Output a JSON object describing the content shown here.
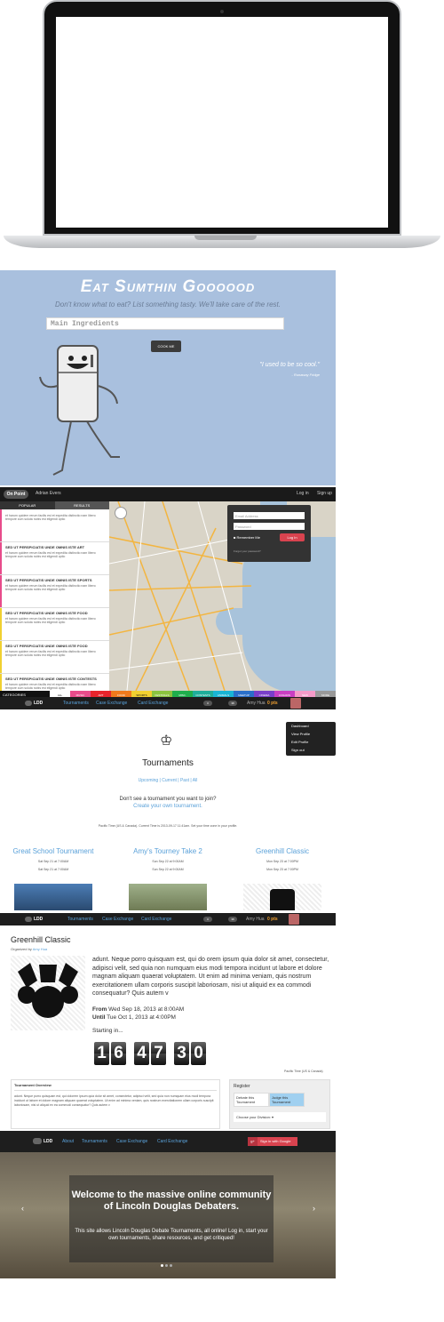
{
  "eat": {
    "title": "Eat Sumthin Goooood",
    "subtitle": "Don't know what to eat? List something tasty. We'll take care of the rest.",
    "placeholder": "Main Ingredients",
    "button": "COOK ME",
    "quote": "\"I used to be so cool.\"",
    "quote_by": "- Runaway Fridge"
  },
  "mapapp": {
    "brand": "On Point",
    "nav_left": "Adrian Evers",
    "login": "Log in",
    "signup": "Sign up",
    "tabs": [
      "POPULAR",
      "RESULTS"
    ],
    "items": [
      {
        "title": "",
        "desc": "et harum quidem rerum facilis est et expedita distinctio nam libero tempore cum soluta nobis est eligendi optio",
        "color": "#e84c8b"
      },
      {
        "title": "SED UT PERSPICIATIS UNDE OMNIS ISTE ART",
        "desc": "et harum quidem rerum facilis est et expedita distinctio nam libero tempore cum soluta nobis est eligendi optio",
        "color": "#e84c8b"
      },
      {
        "title": "SED UT PERSPICIATIS UNDE OMNIS ISTE SPORTS",
        "desc": "et harum quidem rerum facilis est et expedita distinctio nam libero tempore cum soluta nobis est eligendi optio",
        "color": "#e84c8b"
      },
      {
        "title": "SED UT PERSPICIATIS UNDE OMNIS ISTE FOOD",
        "desc": "et harum quidem rerum facilis est et expedita distinctio nam libero tempore cum soluta nobis est eligendi optio",
        "color": "#f0d030"
      },
      {
        "title": "SED UT PERSPICIATIS UNDE OMNIS ISTE FOOD",
        "desc": "et harum quidem rerum facilis est et expedita distinctio nam libero tempore cum soluta nobis est eligendi optio",
        "color": "#f0d030"
      },
      {
        "title": "SED UT PERSPICIATIS UNDE OMNIS ISTE CONTESTS",
        "desc": "et harum quidem rerum facilis est et expedita distinctio nam libero tempore cum soluta nobis est eligendi optio",
        "color": "#f0d030"
      }
    ],
    "email_ph": "Email Address",
    "pass_ph": "Password",
    "remember": "Remember Me",
    "login_btn": "Log In",
    "forgot": "Forgot your password?",
    "categories_label": "CATEGORIES",
    "categories": [
      {
        "name": "ALL",
        "color": "#ffffff",
        "text": "#111"
      },
      {
        "name": "MUSIC",
        "color": "#e84c8b",
        "text": "#fff"
      },
      {
        "name": "ART",
        "color": "#e8242c",
        "text": "#fff"
      },
      {
        "name": "FOOD",
        "color": "#f07a1c",
        "text": "#fff"
      },
      {
        "name": "SPORTS",
        "color": "#f0d030",
        "text": "#111"
      },
      {
        "name": "FESTIVALS",
        "color": "#8bc43f",
        "text": "#fff"
      },
      {
        "name": "MISC.",
        "color": "#1fae4c",
        "text": "#fff"
      },
      {
        "name": "CONTESTS",
        "color": "#1fae9a",
        "text": "#fff"
      },
      {
        "name": "ANIMALS",
        "color": "#19b5d4",
        "text": "#fff"
      },
      {
        "name": "MEETUP",
        "color": "#2a6fc9",
        "text": "#fff"
      },
      {
        "name": "CINEMA",
        "color": "#7a3fc9",
        "text": "#fff"
      },
      {
        "name": "FASHION",
        "color": "#c93fc2",
        "text": "#fff"
      },
      {
        "name": "NEW",
        "color": "#f59bc9",
        "text": "#fff"
      },
      {
        "name": "MORE",
        "color": "#999999",
        "text": "#fff"
      }
    ]
  },
  "ldd": {
    "brand": "LDD",
    "links": [
      "Tournaments",
      "Case Exchange",
      "Card Exchange"
    ],
    "badge1": "0",
    "badge2": "38",
    "user": "Amy Hua",
    "points": "0 pts"
  },
  "tourn": {
    "dropdown": [
      "Dashboard",
      "View Profile",
      "Edit Profile",
      "Sign out"
    ],
    "heading": "Tournaments",
    "filters": "Upcoming | Current | Past | All",
    "question": "Don't see a tournament you want to join?",
    "create": "Create your own tournament.",
    "timezone": "Pacific Time (US & Canada). Current Time is 2013-09-17 11:41am. Set your time zone in your profile.",
    "cards": [
      {
        "title": "Great School Tournament",
        "date1": "Sat Sep 21 at 7:00AM",
        "date2": "Sat Sep 21 at 7:00AM"
      },
      {
        "title": "Amy's Tourney Take 2",
        "date1": "Sun Sep 22 at 9:00AM",
        "date2": "Sun Sep 22 at 9:00AM"
      },
      {
        "title": "Greenhill Classic",
        "date1": "Mon Sep 23 at 7:00PM",
        "date2": "Mon Sep 23 at 7:00PM"
      }
    ]
  },
  "detail": {
    "title": "Greenhill Classic",
    "org_prefix": "Organized by",
    "org_name": "Amy Hua",
    "desc": "adunt. Neque porro quisquam est, qui do orem ipsum quia dolor sit amet, consectetur, adipisci velit, sed quia non numquam eius modi tempora incidunt ut labore et dolore magnam aliquam quaerat voluptatem. Ut enim ad minima veniam, quis nostrum exercitationem ullam corporis suscipit laboriosam, nisi ut aliquid ex ea commodi consequatur? Quis autem v",
    "from_label": "From",
    "from_value": "Wed Sep 18, 2013 at 8:00AM",
    "until_label": "Until",
    "until_value": "Tue Oct 1, 2013 at 4:00PM",
    "starting": "Starting in...",
    "digits": [
      "1",
      "6",
      "4",
      "7",
      "3",
      "0"
    ],
    "tz": "Pacific Time (US & Canada)",
    "overview_title": "Tournament Overview",
    "overview_text": "adunt. Neque porro quisquam est, qui dolorem ipsum quia dolor sit amet, consectetur, adipisci velit, sed quia non numquam eius modi tempora incidunt ut labore et dolore magnam aliquam quaerat voluptatem. Ut enim ad minima veniam, quis nostrum exercitationem ullam corporis suscipit laboriosam, nisi ut aliquid ex ea commodi consequatur? Quis autem v",
    "register": "Register",
    "reg_tabs": [
      "Debate this Tournament",
      "Judge this Tournament"
    ],
    "division": "Choose your Division:"
  },
  "welcome": {
    "brand": "LDD",
    "links": [
      "About",
      "Tournaments",
      "Case Exchange",
      "Card Exchange"
    ],
    "gbtn": "Sign in with Google",
    "gicon": "g+",
    "title": "Welcome to the massive online community of Lincoln Douglas Debaters.",
    "sub": "This site allows Lincoln Douglas Debate Tournaments, all online! Log in, start your own tournaments, share resources, and get critiqued!"
  }
}
